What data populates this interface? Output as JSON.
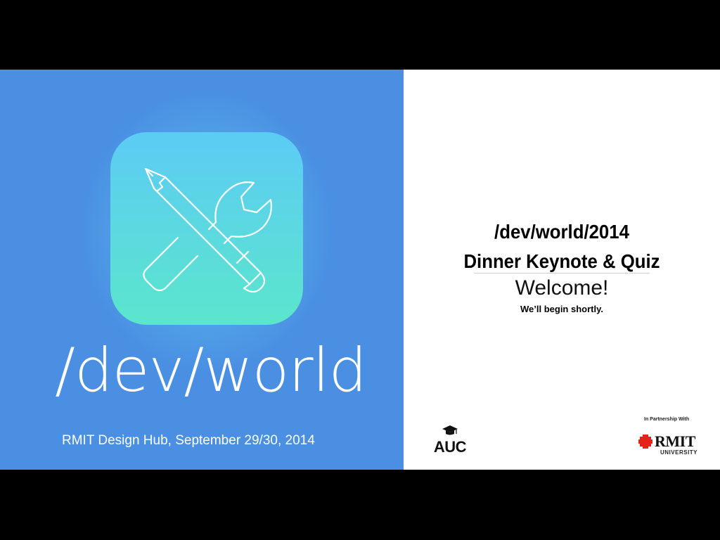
{
  "left": {
    "brand_title": "/dev/world",
    "venue": "RMIT Design Hub, September 29/30, 2014",
    "icon": "pencil-and-wrench-icon",
    "colors": {
      "background": "#4a8fe2",
      "icon_top": "#5ccbf5",
      "icon_bottom": "#5be6cc"
    }
  },
  "right": {
    "title_line1": "/dev/world/2014",
    "title_line2": "Dinner Keynote & Quiz",
    "welcome": "Welcome!",
    "subtitle": "We’ll begin shortly.",
    "auc_logo_text": "AUC",
    "partner_label": "In Partnership With",
    "rmit_name": "RMIT",
    "rmit_sub": "UNIVERSITY",
    "colors": {
      "rmit_red": "#e2231a"
    }
  }
}
